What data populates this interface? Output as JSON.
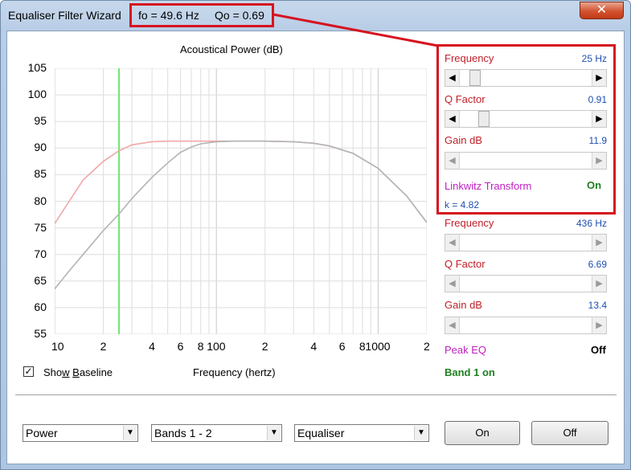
{
  "window": {
    "title": "Equaliser Filter Wizard",
    "fo": "fo = 49.6 Hz",
    "qo": "Qo = 0.69",
    "close_glyph": "✕"
  },
  "plot": {
    "title": "Acoustical Power (dB)",
    "x_axis_label": "Frequency (hertz)",
    "y_ticks": [
      "105",
      "100",
      "95",
      "90",
      "85",
      "80",
      "75",
      "70",
      "65",
      "60",
      "55"
    ],
    "x_ticks": [
      "10",
      "2",
      "4",
      "6",
      "8",
      "100",
      "2",
      "4",
      "6",
      "8",
      "1000",
      "2"
    ],
    "show_baseline_checked": "✓",
    "show_baseline_pre": "Sho",
    "show_baseline_u": "w",
    "show_baseline_mid": " ",
    "show_baseline_u2": "B",
    "show_baseline_post": "aseline"
  },
  "chart_data": {
    "type": "line",
    "xscale": "log",
    "xlim": [
      10,
      2000
    ],
    "ylim": [
      55,
      105
    ],
    "grid": true,
    "cursor_hz": 25,
    "series": [
      {
        "color": "#f0a8a8",
        "x": [
          10,
          12,
          15,
          20,
          25,
          30,
          40,
          50,
          70,
          100,
          150,
          200,
          300,
          400,
          500,
          700,
          1000,
          1500,
          2000
        ],
        "y": [
          75.8,
          79.5,
          84,
          87.5,
          89.5,
          90.6,
          91.2,
          91.3,
          91.3,
          91.3,
          91.3,
          91.3,
          91.2,
          90.9,
          90.4,
          89,
          86.2,
          81,
          76
        ]
      },
      {
        "color": "#b4b4b4",
        "x": [
          10,
          12,
          15,
          20,
          25,
          30,
          40,
          50,
          60,
          70,
          80,
          100,
          130,
          150,
          200,
          300,
          400,
          500,
          700,
          1000,
          1500,
          2000
        ],
        "y": [
          63.5,
          66.5,
          70,
          74.5,
          77.6,
          80.5,
          84.5,
          87.2,
          89.2,
          90.2,
          90.8,
          91.2,
          91.3,
          91.3,
          91.3,
          91.2,
          90.9,
          90.4,
          89,
          86.2,
          81,
          76
        ]
      }
    ]
  },
  "band1": {
    "freq_label": "Frequency",
    "freq_value": "25 Hz",
    "freq_pos": 0.08,
    "q_label": "Q Factor",
    "q_value": "0.91",
    "q_pos": 0.15,
    "gain_label": "Gain  dB",
    "gain_value": "11.9",
    "lt_label": "Linkwitz Transform",
    "lt_value": "On",
    "k_text": "k = 4.82"
  },
  "band2": {
    "freq_label": "Frequency",
    "freq_value": "436 Hz",
    "q_label": "Q Factor",
    "q_value": "6.69",
    "gain_label": "Gain  dB",
    "gain_value": "13.4",
    "peak_label": "Peak EQ",
    "peak_value": "Off"
  },
  "status": {
    "band_on": "Band 1 on"
  },
  "controls": {
    "select1": "Power",
    "select2": "Bands 1 - 2",
    "select3": "Equaliser",
    "on_label": "On",
    "off_label": "Off",
    "dd_glyph": "▼",
    "left_arrow": "◀",
    "right_arrow": "▶"
  },
  "colors": {
    "accent_red": "#d6131f",
    "label_red": "#c0202a",
    "value_blue": "#1f4fb0",
    "magenta": "#c020c0",
    "green": "#208020",
    "cursor_green": "#6ee86e"
  }
}
